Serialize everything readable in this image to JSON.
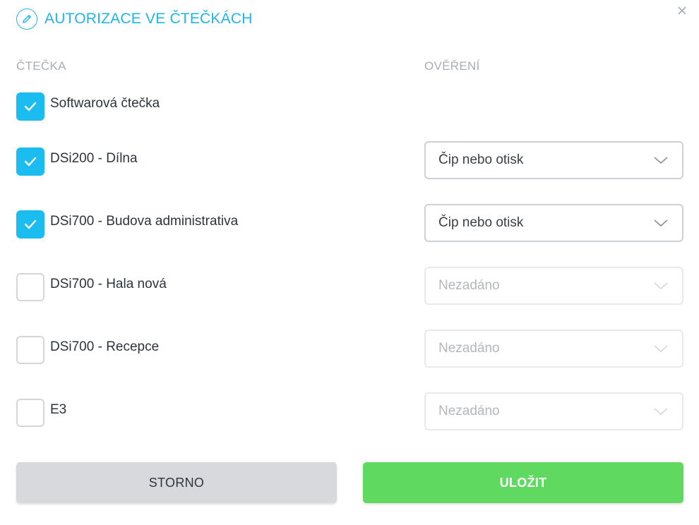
{
  "dialog": {
    "title": "AUTORIZACE VE ČTEČKÁCH",
    "icons": {
      "title": "pencil-icon",
      "close": "close-icon"
    }
  },
  "columns": {
    "reader": "ČTEČKA",
    "verification": "OVĚŘENÍ"
  },
  "readers": [
    {
      "label": "Softwarová čtečka",
      "checked": true,
      "verification": null
    },
    {
      "label": "DSi200 - Dílna",
      "checked": true,
      "verification": "Čip nebo otisk"
    },
    {
      "label": "DSi700 - Budova administrativa",
      "checked": true,
      "verification": "Čip nebo otisk"
    },
    {
      "label": "DSi700 - Hala nová",
      "checked": false,
      "verification": "Nezadáno"
    },
    {
      "label": "DSi700 - Recepce",
      "checked": false,
      "verification": "Nezadáno"
    },
    {
      "label": "E3",
      "checked": false,
      "verification": "Nezadáno"
    }
  ],
  "buttons": {
    "cancel": "STORNO",
    "save": "ULOŽIT"
  },
  "colors": {
    "accent": "#1fb5ea",
    "checkbox_checked": "#1bbcf0",
    "save_button": "#60d961",
    "cancel_button": "#d8d9dd"
  }
}
